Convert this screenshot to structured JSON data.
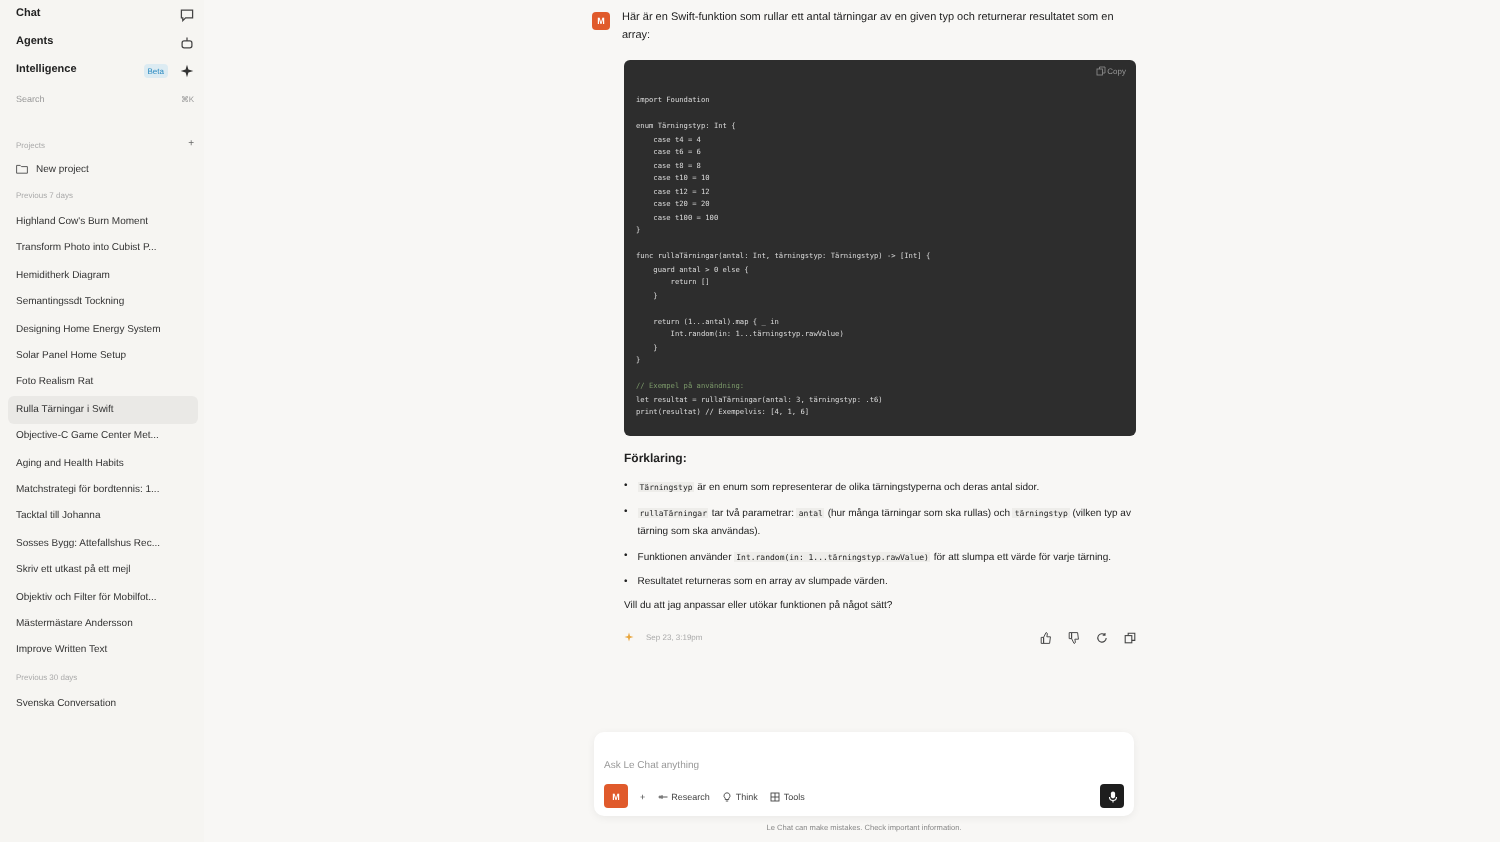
{
  "sidebar": {
    "nav": [
      {
        "label": "Chat"
      },
      {
        "label": "Agents"
      },
      {
        "label": "Intelligence",
        "badge": "Beta"
      }
    ],
    "search": {
      "label": "Search",
      "shortcut": "⌘K"
    },
    "projects": {
      "heading": "Projects",
      "add": "+",
      "new_project": "New project"
    },
    "groups": [
      {
        "heading": "Previous 7 days",
        "items": [
          {
            "label": "Highland Cow's Burn Moment",
            "selected": false
          },
          {
            "label": "Transform Photo into Cubist P...",
            "selected": false
          },
          {
            "label": "Hemiditherk Diagram",
            "selected": false
          },
          {
            "label": "Semantingssdt Tockning",
            "selected": false
          },
          {
            "label": "Designing Home Energy System",
            "selected": false
          },
          {
            "label": "Solar Panel Home Setup",
            "selected": false
          },
          {
            "label": "Foto Realism Rat",
            "selected": false
          },
          {
            "label": "Rulla Tärningar i Swift",
            "selected": true
          },
          {
            "label": "Objective-C Game Center Met...",
            "selected": false
          },
          {
            "label": "Aging and Health Habits",
            "selected": false
          },
          {
            "label": "Matchstrategi för bordtennis: 1...",
            "selected": false
          },
          {
            "label": "Tacktal till Johanna",
            "selected": false
          },
          {
            "label": "Sosses Bygg: Attefallshus Rec...",
            "selected": false
          },
          {
            "label": "Skriv ett utkast på ett mejl",
            "selected": false
          },
          {
            "label": "Objektiv och Filter för Mobilfot...",
            "selected": false
          },
          {
            "label": "Mästermästare Andersson",
            "selected": false
          },
          {
            "label": "Improve Written Text",
            "selected": false
          }
        ]
      },
      {
        "heading": "Previous 30 days",
        "items": [
          {
            "label": "Svenska Conversation",
            "selected": false
          }
        ]
      }
    ]
  },
  "message": {
    "avatar": "M",
    "intro": "Här är en Swift-funktion som rullar ett antal tärningar av en given typ och returnerar resultatet som en array:",
    "code": {
      "copy": "Copy",
      "lines": [
        {
          "kind": "code",
          "text": "import Foundation"
        },
        {
          "kind": "blank"
        },
        {
          "kind": "code",
          "text": "enum Tärningstyp: Int {"
        },
        {
          "kind": "code",
          "text": "    case t4 = 4"
        },
        {
          "kind": "code",
          "text": "    case t6 = 6"
        },
        {
          "kind": "code",
          "text": "    case t8 = 8"
        },
        {
          "kind": "code",
          "text": "    case t10 = 10"
        },
        {
          "kind": "code",
          "text": "    case t12 = 12"
        },
        {
          "kind": "code",
          "text": "    case t20 = 20"
        },
        {
          "kind": "code",
          "text": "    case t100 = 100"
        },
        {
          "kind": "code",
          "text": "}"
        },
        {
          "kind": "blank"
        },
        {
          "kind": "code",
          "text": "func rullaTärningar(antal: Int, tärningstyp: Tärningstyp) -> [Int] {"
        },
        {
          "kind": "code",
          "text": "    guard antal > 0 else {"
        },
        {
          "kind": "code",
          "text": "        return []"
        },
        {
          "kind": "code",
          "text": "    }"
        },
        {
          "kind": "blank"
        },
        {
          "kind": "code",
          "text": "    return (1...antal).map { _ in"
        },
        {
          "kind": "code",
          "text": "        Int.random(in: 1...tärningstyp.rawValue)"
        },
        {
          "kind": "code",
          "text": "    }"
        },
        {
          "kind": "code",
          "text": "}"
        },
        {
          "kind": "blank"
        },
        {
          "kind": "comment",
          "text": "// Exempel på användning:"
        },
        {
          "kind": "code",
          "text": "let resultat = rullaTärningar(antal: 3, tärningstyp: .t6)"
        },
        {
          "kind": "code",
          "text": "print(resultat) // Exempelvis: [4, 1, 6]"
        }
      ]
    },
    "heading": "Förklaring:",
    "bullets": [
      {
        "marker": "•",
        "parts": [
          {
            "kind": "code",
            "text": "Tärningstyp"
          },
          {
            "kind": "text",
            "text": " är en enum som representerar de olika tärningstyperna och deras antal sidor."
          }
        ]
      },
      {
        "marker": "•",
        "parts": [
          {
            "kind": "code",
            "text": "rullaTärningar"
          },
          {
            "kind": "text",
            "text": " tar två parametrar: "
          },
          {
            "kind": "code",
            "text": "antal"
          },
          {
            "kind": "text",
            "text": " (hur många tärningar som ska rullas) och "
          },
          {
            "kind": "code",
            "text": "tärningstyp"
          },
          {
            "kind": "text",
            "text": " (vilken typ av tärning som ska användas)."
          }
        ]
      },
      {
        "marker": "•",
        "parts": [
          {
            "kind": "text",
            "text": "Funktionen använder "
          },
          {
            "kind": "code",
            "text": "Int.random(in: 1...tärningstyp.rawValue)"
          },
          {
            "kind": "text",
            "text": " för att slumpa ett värde för varje tärning."
          }
        ]
      },
      {
        "marker": "•",
        "parts": [
          {
            "kind": "text",
            "text": "Resultatet returneras som en array av slumpade värden."
          }
        ]
      }
    ],
    "question": "Vill du att jag anpassar eller utökar funktionen på något sätt?",
    "timestamp": "Sep 23, 3:19pm"
  },
  "composer": {
    "placeholder": "Ask Le Chat anything",
    "avatar": "M",
    "add": "+",
    "tools": [
      {
        "label": "Research"
      },
      {
        "label": "Think"
      },
      {
        "label": "Tools"
      }
    ]
  },
  "disclaimer": "Le Chat can make mistakes. Check important information."
}
